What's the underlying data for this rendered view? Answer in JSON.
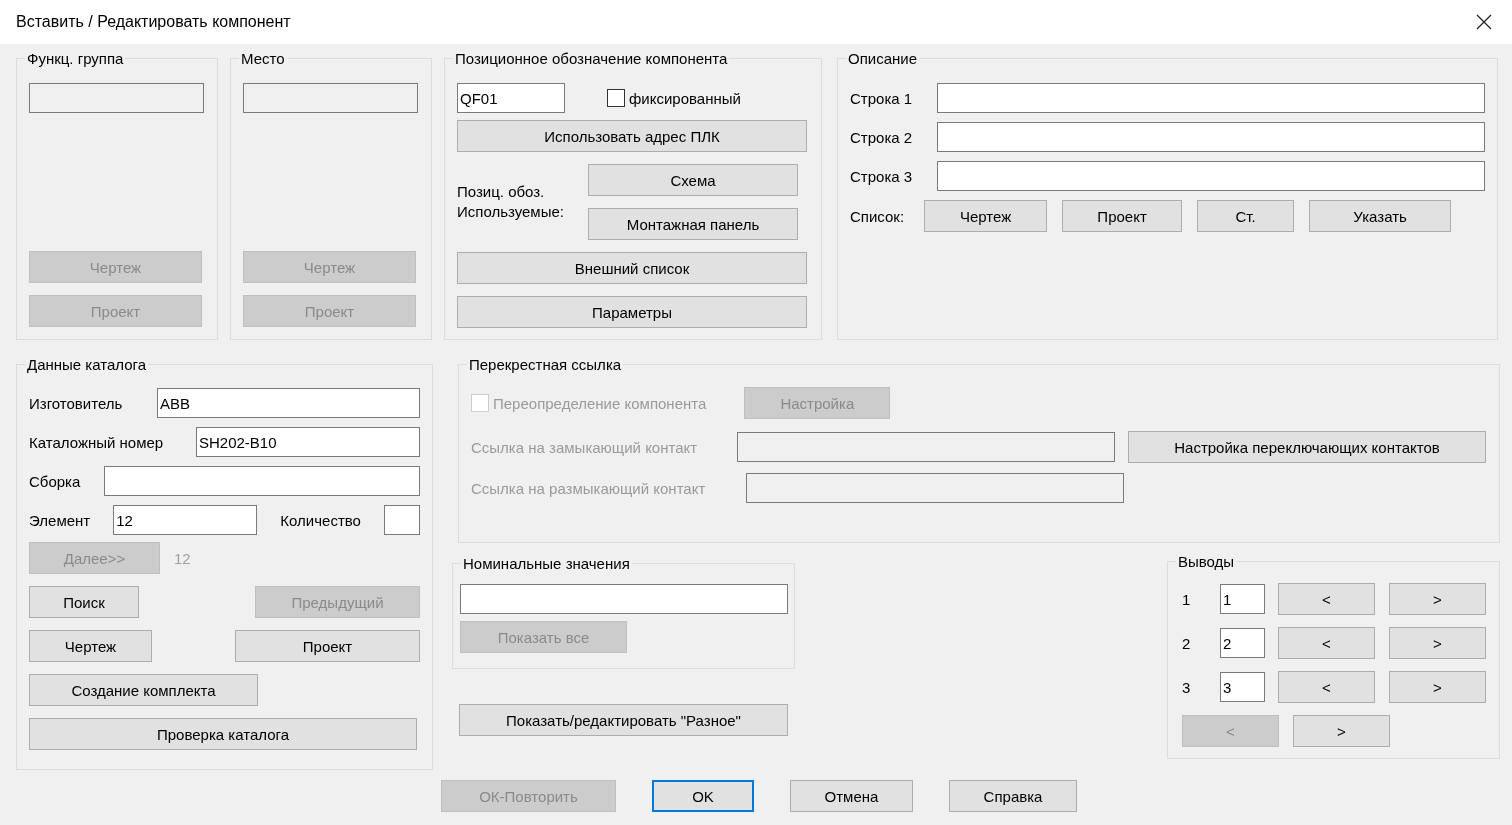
{
  "window": {
    "title": "Вставить / Редактировать компонент"
  },
  "func_group": {
    "title": "Функц. группа",
    "field": {
      "disabled": true
    },
    "drawing": {
      "label": "Чертеж",
      "disabled": true
    },
    "project": {
      "label": "Проект",
      "disabled": true
    }
  },
  "location": {
    "title": "Место",
    "field": {
      "disabled": true
    },
    "drawing": {
      "label": "Чертеж",
      "disabled": true
    },
    "project": {
      "label": "Проект",
      "disabled": true
    }
  },
  "tag": {
    "title": "Позиционное обозначение компонента",
    "value": "QF01",
    "fixed": {
      "label": "фиксированный",
      "checked": false,
      "disabled": false
    },
    "plc": {
      "label": "Использовать адрес ПЛК",
      "disabled": false
    },
    "used_label": "Позиц. обоз. Используемые:",
    "schematic": {
      "label": "Схема",
      "disabled": false
    },
    "panel": {
      "label": "Монтажная панель",
      "disabled": false
    },
    "external_list": {
      "label": "Внешний список",
      "disabled": false
    },
    "parameters": {
      "label": "Параметры",
      "disabled": false
    }
  },
  "description": {
    "title": "Описание",
    "lines": [
      {
        "label": "Строка 1"
      },
      {
        "label": "Строка 2"
      },
      {
        "label": "Строка 3"
      }
    ],
    "list_label": "Список:",
    "list_buttons": [
      {
        "label": "Чертеж",
        "disabled": false
      },
      {
        "label": "Проект",
        "disabled": false
      },
      {
        "label": "Ст.",
        "disabled": false
      },
      {
        "label": "Указать",
        "disabled": false
      }
    ]
  },
  "catalog": {
    "title": "Данные каталога",
    "manufacturer": {
      "label": "Изготовитель",
      "value": "ABB"
    },
    "catalog_number": {
      "label": "Каталожный номер",
      "value": "SH202-B10"
    },
    "assembly": {
      "label": "Сборка"
    },
    "item": {
      "label": "Элемент",
      "value": "12"
    },
    "quantity": {
      "label": "Количество"
    },
    "next": {
      "label": "Далее>>",
      "disabled": true
    },
    "next_count": "12",
    "search": {
      "label": "Поиск",
      "disabled": false
    },
    "previous": {
      "label": "Предыдущий",
      "disabled": true
    },
    "drawing": {
      "label": "Чертеж",
      "disabled": false
    },
    "project": {
      "label": "Проект",
      "disabled": false
    },
    "create_kit": {
      "label": "Создание комплекта",
      "disabled": false
    },
    "check": {
      "label": "Проверка каталога",
      "disabled": false
    }
  },
  "cross_reference": {
    "title": "Перекрестная ссылка",
    "override": {
      "label": "Переопределение компонента",
      "checked": false,
      "disabled": true
    },
    "setup": {
      "label": "Настройка",
      "disabled": true
    },
    "no_contact": {
      "label": "Ссылка на замыкающий контакт",
      "disabled": true
    },
    "nc_contact": {
      "label": "Ссылка на размыкающий контакт",
      "disabled": true
    },
    "switch_setup": {
      "label": "Настройка переключающих контактов",
      "disabled": false
    }
  },
  "ratings": {
    "title": "Номинальные значения",
    "show_all": {
      "label": "Показать все",
      "disabled": true
    }
  },
  "misc": {
    "label": "Показать/редактировать \"Разное\"",
    "disabled": false
  },
  "pins": {
    "title": "Выводы",
    "rows": [
      {
        "number": "1",
        "value": "1",
        "prev": {
          "label": "<",
          "disabled": false
        },
        "next": {
          "label": ">",
          "disabled": false
        }
      },
      {
        "number": "2",
        "value": "2",
        "prev": {
          "label": "<",
          "disabled": false
        },
        "next": {
          "label": ">",
          "disabled": false
        }
      },
      {
        "number": "3",
        "value": "3",
        "prev": {
          "label": "<",
          "disabled": false
        },
        "next": {
          "label": ">",
          "disabled": false
        }
      }
    ],
    "prev": {
      "label": "<",
      "disabled": true
    },
    "next": {
      "label": ">",
      "disabled": false
    }
  },
  "footer": [
    {
      "label": "ОК-Повторить",
      "disabled": true,
      "default": false
    },
    {
      "label": "OK",
      "disabled": false,
      "default": true
    },
    {
      "label": "Отмена",
      "disabled": false,
      "default": false
    },
    {
      "label": "Справка",
      "disabled": false,
      "default": false
    }
  ]
}
